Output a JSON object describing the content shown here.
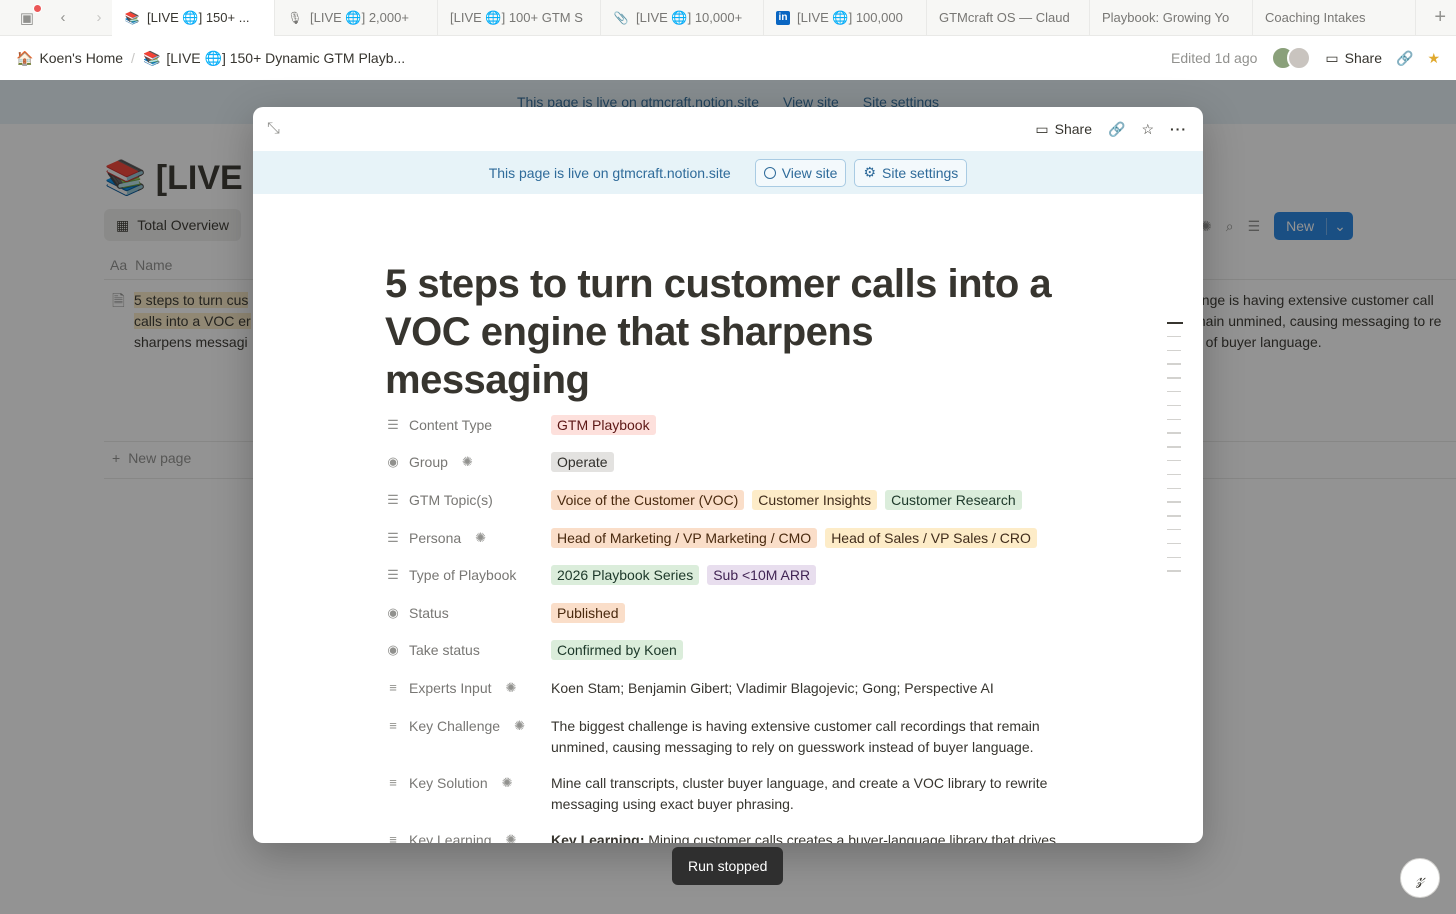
{
  "tabbar": {
    "tabs": [
      {
        "label": "[LIVE 🌐] 150+ ...",
        "icon": "📚"
      },
      {
        "label": "[LIVE 🌐] 2,000+",
        "icon": "🎙"
      },
      {
        "label": "[LIVE 🌐] 100+ GTM S",
        "icon": ""
      },
      {
        "label": "[LIVE 🌐] 10,000+",
        "icon": "📎"
      },
      {
        "label": "[LIVE 🌐] 100,000",
        "icon": "in"
      },
      {
        "label": "GTMcraft OS — Claud",
        "icon": ""
      },
      {
        "label": "Playbook: Growing Yo",
        "icon": ""
      },
      {
        "label": "Coaching Intakes",
        "icon": ""
      }
    ]
  },
  "breadcrumb": {
    "home": "Koen's Home",
    "home_icon": "🏠",
    "page": "[LIVE 🌐] 150+ Dynamic GTM Playb...",
    "page_icon": "📚",
    "edited": "Edited 1d ago",
    "share": "Share"
  },
  "background": {
    "banner_text": "This page is live on gtmcraft.notion.site",
    "view_site": "View site",
    "site_settings": "Site settings",
    "title": "[LIVE",
    "title_icon": "📚",
    "view_tab": "Total Overview",
    "new_button": "New",
    "col_name": "Name",
    "row_name_lines": [
      "5 steps to turn cus",
      "calls into a VOC er",
      "sharpens messagi"
    ],
    "row_right_lines": [
      "enge is having extensive customer call",
      "main unmined, causing messaging to re",
      "d of buyer language."
    ],
    "new_page": "New page"
  },
  "modal": {
    "share": "Share",
    "banner_text": "This page is live on gtmcraft.notion.site",
    "view_site": "View site",
    "site_settings": "Site settings",
    "title": "5 steps to turn customer calls into a VOC engine that sharpens messaging",
    "properties": {
      "content_type": {
        "label": "Content Type",
        "tags": [
          "GTM Playbook"
        ]
      },
      "group": {
        "label": "Group",
        "tags": [
          "Operate"
        ]
      },
      "gtm_topics": {
        "label": "GTM Topic(s)",
        "tags": [
          "Voice of the Customer (VOC)",
          "Customer Insights",
          "Customer Research"
        ]
      },
      "persona": {
        "label": "Persona",
        "tags": [
          "Head of Marketing / VP Marketing / CMO",
          "Head of Sales / VP Sales / CRO"
        ]
      },
      "type_of_playbook": {
        "label": "Type of Playbook",
        "tags": [
          "2026 Playbook Series",
          "Sub <10M ARR"
        ]
      },
      "status": {
        "label": "Status",
        "tags": [
          "Published"
        ]
      },
      "take_status": {
        "label": "Take status",
        "tags": [
          "Confirmed by Koen"
        ]
      },
      "experts_input": {
        "label": "Experts Input",
        "value": "Koen Stam; Benjamin Gibert; Vladimir Blagojevic; Gong; Perspective AI"
      },
      "key_challenge": {
        "label": "Key Challenge",
        "value": "The biggest challenge is having extensive customer call recordings that remain unmined, causing messaging to rely on guesswork instead of buyer language."
      },
      "key_solution": {
        "label": "Key Solution",
        "value": "Mine call transcripts, cluster buyer language, and create a VOC library to rewrite messaging using exact buyer phrasing."
      },
      "key_learning": {
        "label": "Key Learning",
        "bold": "Key Learning:",
        "value": " Mining customer calls creates a buyer-language library that drives"
      }
    }
  },
  "toast": "Run stopped",
  "colors": {
    "accent": "#2383e2",
    "banner": "#e7f3f8",
    "overlay": "rgba(15,15,15,0.45)"
  }
}
